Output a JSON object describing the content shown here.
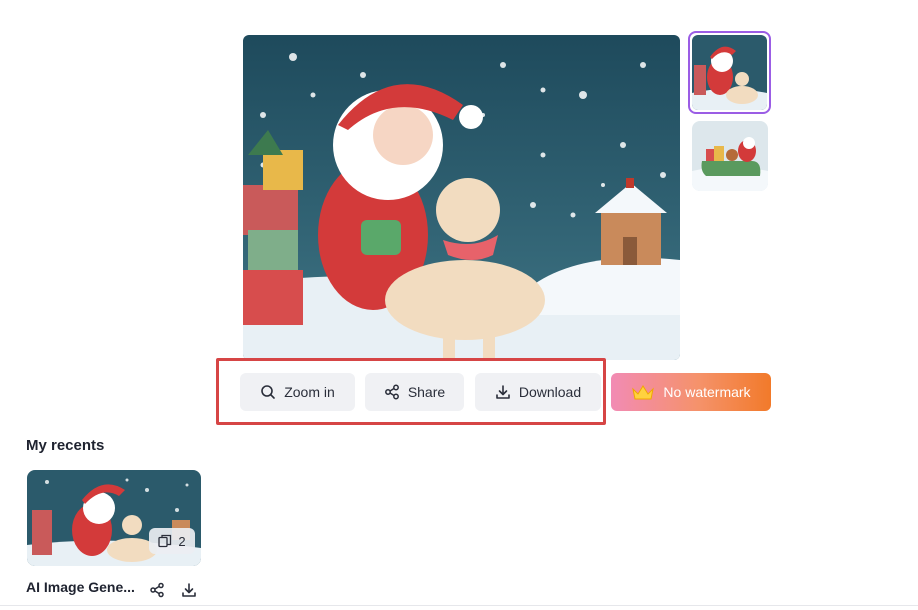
{
  "actions": {
    "zoom_label": "Zoom in",
    "share_label": "Share",
    "download_label": "Download",
    "no_watermark_label": "No watermark"
  },
  "recents": {
    "title": "My recents",
    "items": [
      {
        "name": "AI Image Gene...",
        "count": "2"
      }
    ]
  },
  "icons": {
    "zoom": "search-icon",
    "share": "share-icon",
    "download": "download-icon",
    "crown": "crown-icon",
    "copies": "copy-stack-icon"
  },
  "colors": {
    "accent_border": "#9b5de5",
    "highlight": "#d64545",
    "premium_gradient_start": "#f28bb4",
    "premium_gradient_end": "#f27a2a"
  }
}
